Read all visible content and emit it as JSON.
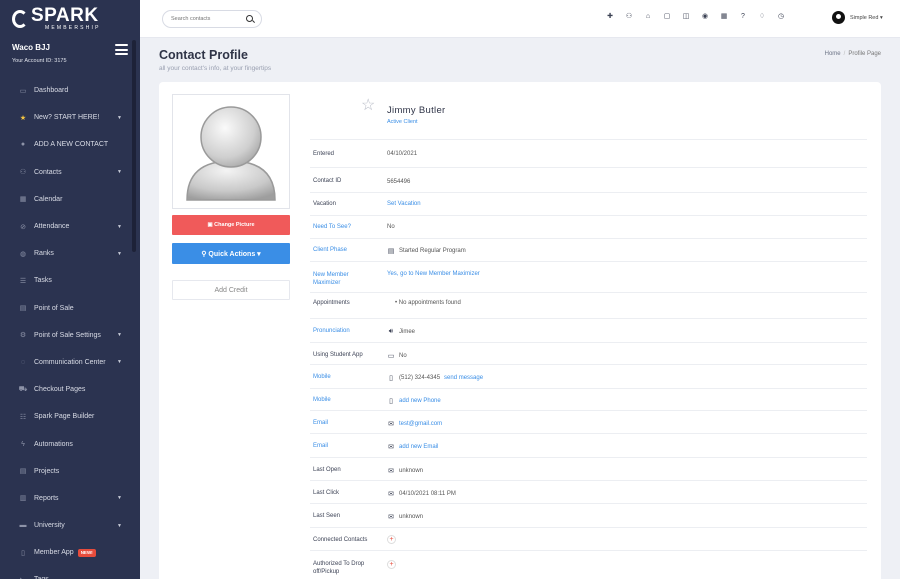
{
  "brand": {
    "logo_text": "SPARK",
    "logo_sub": "MEMBERSHIP"
  },
  "account": {
    "name": "Waco BJJ",
    "id_text": "Your Account ID: 3175"
  },
  "nav": [
    {
      "label": "Dashboard",
      "icon": "monitor-icon",
      "glyph": "▭",
      "caret": false
    },
    {
      "label": "New? START HERE!",
      "icon": "star-icon",
      "glyph": "★",
      "caret": true
    },
    {
      "label": "ADD A NEW CONTACT",
      "icon": "user-plus-icon",
      "glyph": "●",
      "caret": false
    },
    {
      "label": "Contacts",
      "icon": "users-icon",
      "glyph": "⚇",
      "caret": true
    },
    {
      "label": "Calendar",
      "icon": "calendar-icon",
      "glyph": "▦",
      "caret": false
    },
    {
      "label": "Attendance",
      "icon": "check-circle-icon",
      "glyph": "⊘",
      "caret": true
    },
    {
      "label": "Ranks",
      "icon": "ranks-icon",
      "glyph": "◍",
      "caret": true
    },
    {
      "label": "Tasks",
      "icon": "list-icon",
      "glyph": "☰",
      "caret": false
    },
    {
      "label": "Point of Sale",
      "icon": "pos-icon",
      "glyph": "▤",
      "caret": false
    },
    {
      "label": "Point of Sale Settings",
      "icon": "gears-icon",
      "glyph": "⚙",
      "caret": true
    },
    {
      "label": "Communication Center",
      "icon": "chat-icon",
      "glyph": "◌",
      "caret": true
    },
    {
      "label": "Checkout Pages",
      "icon": "cart-icon",
      "glyph": "⛟",
      "caret": false
    },
    {
      "label": "Spark Page Builder",
      "icon": "page-builder-icon",
      "glyph": "☷",
      "caret": false
    },
    {
      "label": "Automations",
      "icon": "bolt-icon",
      "glyph": "ϟ",
      "caret": false
    },
    {
      "label": "Projects",
      "icon": "projects-icon",
      "glyph": "▤",
      "caret": false
    },
    {
      "label": "Reports",
      "icon": "bar-chart-icon",
      "glyph": "▥",
      "caret": true
    },
    {
      "label": "University",
      "icon": "graduation-icon",
      "glyph": "▬",
      "caret": true
    },
    {
      "label": "Member App",
      "icon": "mobile-icon",
      "glyph": "▯",
      "caret": false,
      "badge": "NEW!"
    },
    {
      "label": "Tags",
      "icon": "tags-icon",
      "glyph": "◣",
      "caret": false
    }
  ],
  "topbar": {
    "search_placeholder": "Search contacts",
    "icons": [
      {
        "name": "add-user-icon",
        "glyph": "✚"
      },
      {
        "name": "group-icon",
        "glyph": "⚇"
      },
      {
        "name": "bank-icon",
        "glyph": "⌂"
      },
      {
        "name": "calendar-icon",
        "glyph": "▢"
      },
      {
        "name": "ticket-icon",
        "glyph": "◫"
      },
      {
        "name": "chat-icon",
        "glyph": "◉"
      },
      {
        "name": "grid-icon",
        "glyph": "▦"
      },
      {
        "name": "help-icon",
        "glyph": "?"
      },
      {
        "name": "bell-icon",
        "glyph": "♢"
      },
      {
        "name": "clock-icon",
        "glyph": "◷"
      }
    ],
    "user_name": "Simple Red ▾"
  },
  "page": {
    "title": "Contact Profile",
    "subtitle": "all your contact's info, at your fingertips"
  },
  "breadcrumb": {
    "home": "Home",
    "sep": "/",
    "current": "Profile Page"
  },
  "profile": {
    "change_picture_label": "▣ Change Picture",
    "quick_actions_label": "⚲ Quick Actions ▾",
    "add_credit_label": "Add Credit",
    "name": "Jimmy Butler",
    "status": "Active Client"
  },
  "fields": {
    "entered": {
      "label": "Entered",
      "value": "04/10/2021"
    },
    "contact_id": {
      "label": "Contact ID",
      "value": "5654496"
    },
    "vacation": {
      "label": "Vacation",
      "value": "Set Vacation"
    },
    "need_to_see": {
      "label": "Need To See?",
      "value": "No"
    },
    "client_phase": {
      "label": "Client Phase",
      "value": "Started Regular Program"
    },
    "new_member_1": {
      "label": "New Member",
      "label2": "Maximizer",
      "value": "Yes, go to New Member Maximizer"
    },
    "appointments": {
      "label": "Appointments",
      "value": "•  No appointments found"
    },
    "pronunciation": {
      "label": "Pronunciation",
      "value": "Jimee"
    },
    "student_app": {
      "label": "Using Student App",
      "value": "No"
    },
    "mobile_1": {
      "label": "Mobile",
      "value": "(512) 324-4345",
      "link": "send message"
    },
    "mobile_2": {
      "label": "Mobile",
      "value": "add new Phone"
    },
    "email_1": {
      "label": "Email",
      "value": "test@gmail.com"
    },
    "email_2": {
      "label": "Email",
      "value": "add new Email"
    },
    "last_open": {
      "label": "Last Open",
      "value": "unknown"
    },
    "last_click": {
      "label": "Last Click",
      "value": "04/10/2021 08:11 PM"
    },
    "last_seen": {
      "label": "Last Seen",
      "value": "unknown"
    },
    "connected": {
      "label": "Connected Contacts"
    },
    "authorized": {
      "label": "Authorized To Drop",
      "label2": "off/Pickup"
    }
  }
}
